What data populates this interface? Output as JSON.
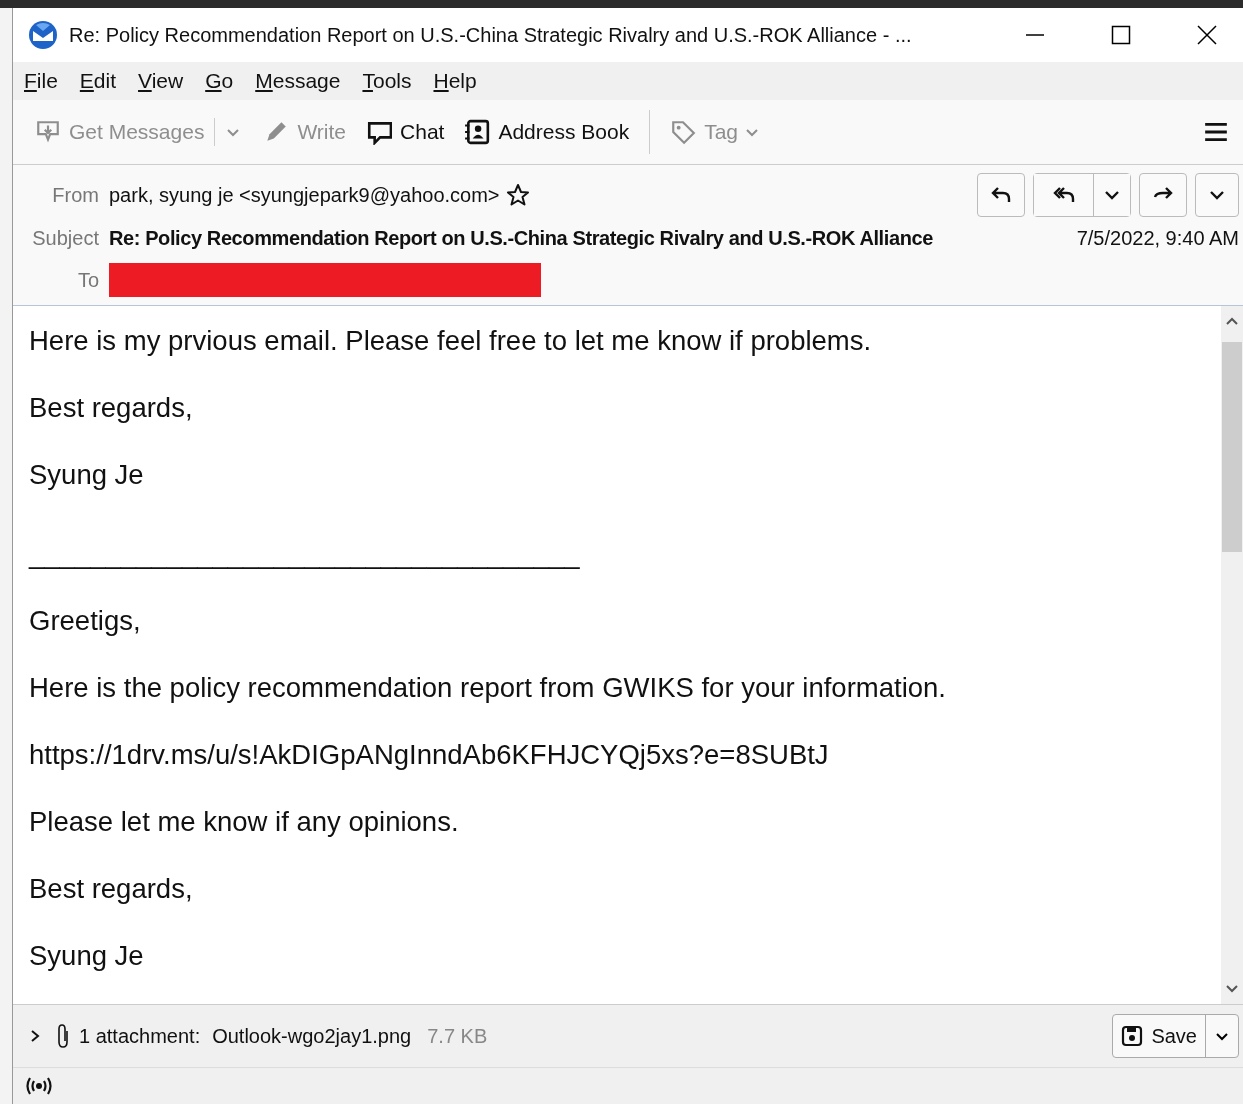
{
  "window": {
    "title": "Re: Policy Recommendation Report on U.S.-China Strategic Rivalry and U.S.-ROK Alliance - ..."
  },
  "menu": [
    {
      "label": "File"
    },
    {
      "label": "Edit"
    },
    {
      "label": "View"
    },
    {
      "label": "Go"
    },
    {
      "label": "Message"
    },
    {
      "label": "Tools"
    },
    {
      "label": "Help"
    }
  ],
  "toolbar": [
    {
      "kind": "split",
      "label": "Get Messages",
      "disabled": true
    },
    {
      "kind": "button",
      "label": "Write",
      "disabled": true
    },
    {
      "kind": "button",
      "label": "Chat",
      "disabled": false
    },
    {
      "kind": "button",
      "label": "Address Book",
      "disabled": false
    },
    {
      "kind": "menu",
      "label": "Tag",
      "disabled": true
    }
  ],
  "header": {
    "from_label": "From",
    "from": "park, syung je <syungjepark9@yahoo.com>",
    "starred": false,
    "subject_label": "Subject",
    "subject": "Re: Policy Recommendation Report on U.S.-China Strategic Rivalry and U.S.-ROK Alliance",
    "date": "7/5/2022, 9:40 AM",
    "to_label": "To",
    "to_redacted": true
  },
  "body": [
    {
      "kind": "text",
      "text": "Here is my prvious email. Please feel free to let me know if problems."
    },
    {
      "kind": "text",
      "text": "Best regards,"
    },
    {
      "kind": "text",
      "text": "Syung Je"
    },
    {
      "kind": "rule",
      "text": "____________________________________"
    },
    {
      "kind": "text",
      "text": "Greetigs,"
    },
    {
      "kind": "text",
      "text": "Here is the policy recommendation report from GWIKS for your information."
    },
    {
      "kind": "text",
      "text": "https://1drv.ms/u/s!AkDIGpANgInndAb6KFHJCYQj5xs?e=8SUBtJ"
    },
    {
      "kind": "text",
      "text": "Please let me know if any opinions."
    },
    {
      "kind": "text",
      "text": "Best regards,"
    },
    {
      "kind": "text",
      "text": "Syung Je"
    }
  ],
  "attachments": {
    "expanded": false,
    "summary": "1 attachment:",
    "name": "Outlook-wgo2jay1.png",
    "size": "7.7 KB",
    "save_label": "Save"
  }
}
